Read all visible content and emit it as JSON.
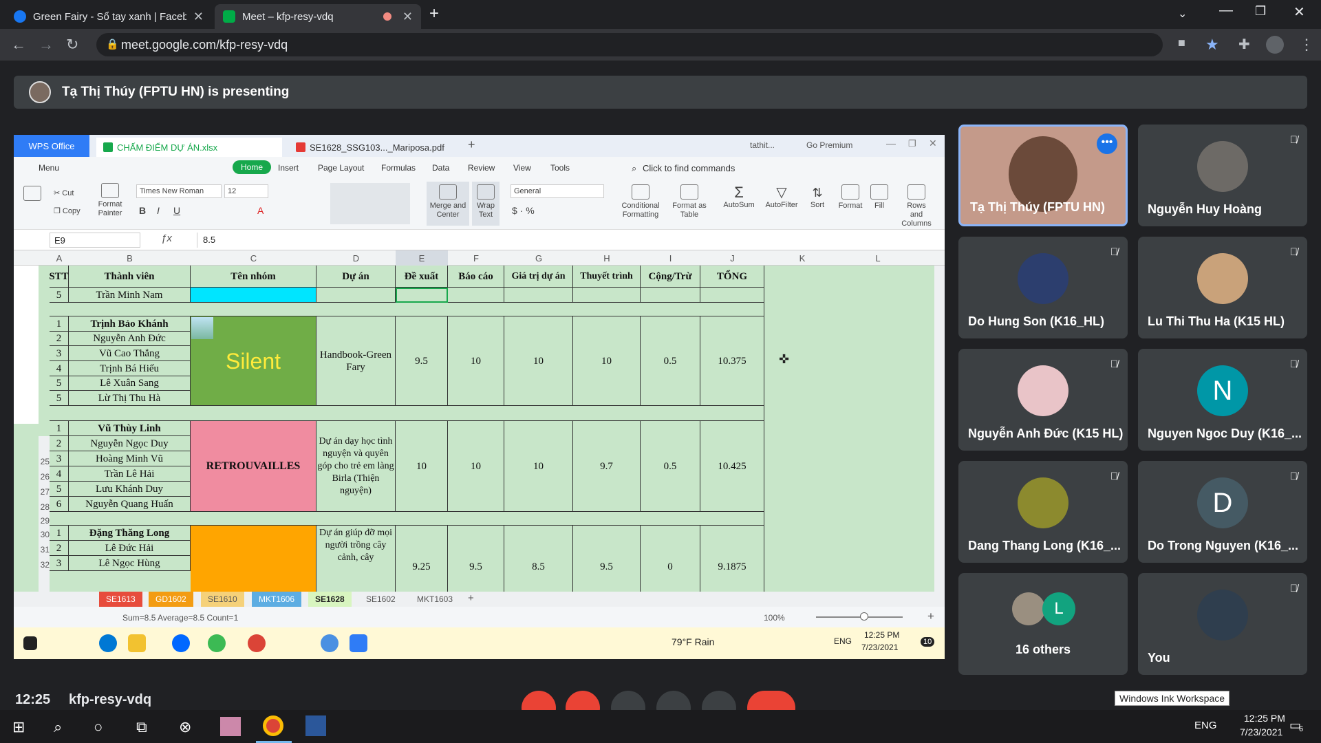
{
  "browser": {
    "tabs": [
      {
        "label": "Green Fairy - Sổ tay xanh | Faceb"
      },
      {
        "label": "Meet – kfp-resy-vdq"
      }
    ],
    "url": "meet.google.com/kfp-resy-vdq"
  },
  "meet": {
    "presenting": "Tạ Thị Thúy (FPTU HN) is presenting",
    "meeting_code": "kfp-resy-vdq",
    "time": "12:25",
    "ink_tooltip": "Windows Ink Workspace"
  },
  "wps": {
    "logo": "WPS Office",
    "tabs": [
      {
        "label": "CHẤM ĐIỂM DỰ ÁN.xlsx"
      },
      {
        "label": "SE1628_SSG103..._Mariposa.pdf"
      }
    ],
    "user": "tathit...",
    "premium": "Go Premium",
    "menu": [
      "Menu",
      "Home",
      "Insert",
      "Page Layout",
      "Formulas",
      "Data",
      "Review",
      "View",
      "Tools"
    ],
    "find": "Click to find commands",
    "font": "Times New Roman",
    "font_size": "12",
    "number_format": "General",
    "ribbon": {
      "cut": "Cut",
      "copy": "Copy",
      "format_painter": "Format Painter",
      "merge": "Merge and Center",
      "wrap": "Wrap Text",
      "cond": "Conditional Formatting",
      "format_table": "Format as Table",
      "autosum": "AutoSum",
      "autofilter": "AutoFilter",
      "sort": "Sort",
      "format": "Format",
      "fill": "Fill",
      "rows_cols": "Rows and Columns"
    },
    "cell_ref": "E9",
    "formula": "8.5",
    "columns": [
      "A",
      "B",
      "C",
      "D",
      "E",
      "F",
      "G",
      "H",
      "I",
      "J",
      "K",
      "L"
    ],
    "headers": [
      "STT",
      "Thành viên",
      "Tên nhóm",
      "Dự án",
      "Đề xuất",
      "Báo cáo",
      "Giá trị dự án",
      "Thuyết trình",
      "Cộng/Trừ",
      "TỔNG"
    ],
    "row_numbers": [
      "25",
      "26",
      "27",
      "28",
      "29",
      "30",
      "31",
      "32"
    ],
    "row_prev": {
      "stt": "5",
      "name": "Trần Minh Nam"
    },
    "group1": {
      "members": [
        "Trịnh Bảo Khánh",
        "Nguyễn Anh Đức",
        "Vũ Cao Thắng",
        "Trịnh Bá Hiếu",
        "Lê Xuân Sang",
        "Lừ Thị Thu Hà"
      ],
      "stt": [
        "1",
        "2",
        "3",
        "4",
        "5",
        "5"
      ],
      "team": "Silent",
      "project": "Handbook-Green Fary",
      "scores": [
        "9.5",
        "10",
        "10",
        "10",
        "0.5",
        "10.375"
      ]
    },
    "group2": {
      "members": [
        "Vũ Thùy Linh",
        "Nguyễn Ngọc Duy",
        "Hoàng Minh Vũ",
        "Trần Lê Hải",
        "Lưu Khánh Duy",
        "Nguyễn Quang Huấn"
      ],
      "stt": [
        "1",
        "2",
        "3",
        "4",
        "5",
        "6"
      ],
      "team": "RETROUVAILLES",
      "project": "Dự án dạy học tình nguyện và quyên góp cho trẻ em làng Birla (Thiện nguyện)",
      "scores": [
        "10",
        "10",
        "10",
        "9.7",
        "0.5",
        "10.425"
      ]
    },
    "group3": {
      "members": [
        "Đặng Thăng Long",
        "Lê Đức Hải",
        "Lê Ngọc Hùng"
      ],
      "stt": [
        "1",
        "2",
        "3"
      ],
      "project": "Dự án giúp đỡ mọi người trồng cây cảnh, cây",
      "scores": [
        "9.25",
        "9.5",
        "8.5",
        "9.5",
        "0",
        "9.1875"
      ]
    },
    "sheets": [
      "SE1613",
      "GD1602",
      "SE1610",
      "MKT1606",
      "SE1628",
      "SE1602",
      "MKT1603"
    ],
    "status": "Sum=8.5  Average=8.5  Count=1",
    "zoom": "100%",
    "weather": "79°F  Rain",
    "lang": "ENG",
    "clock_time": "12:25 PM",
    "clock_date": "7/23/2021",
    "notif": "10"
  },
  "participants": [
    {
      "name": "Tạ Thị Thúy (FPTU HN)"
    },
    {
      "name": "Nguyễn Huy Hoàng"
    },
    {
      "name": "Do Hung Son (K16_HL)"
    },
    {
      "name": "Lu Thi Thu Ha (K15 HL)"
    },
    {
      "name": "Nguyễn Anh Đức (K15 HL)"
    },
    {
      "name": "Nguyen Ngoc Duy (K16_...",
      "initial": "N"
    },
    {
      "name": "Dang Thang Long (K16_..."
    },
    {
      "name": "Do Trong Nguyen (K16_...",
      "initial": "D"
    },
    {
      "name": "16 others",
      "initial": "L"
    },
    {
      "name": "You"
    }
  ],
  "taskbar": {
    "lang": "ENG",
    "time": "12:25 PM",
    "date": "7/23/2021",
    "notif": "6"
  },
  "colors": {
    "green_cell": "#70ad47",
    "pink_cell": "#f08ca0",
    "orange_cell": "#ffa500",
    "cyan_cell": "#00e5ff",
    "sheet_bg": "#c8e6c9",
    "meet_bg": "#202124"
  }
}
